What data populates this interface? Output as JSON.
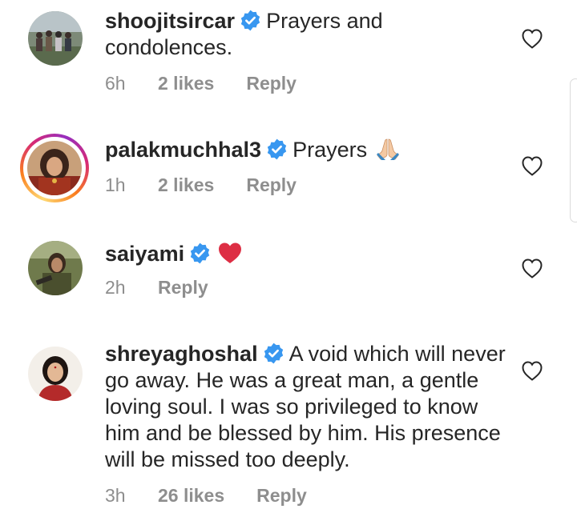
{
  "comments": [
    {
      "username": "shoojitsircar",
      "verified": true,
      "text": "Prayers and condolences.",
      "time": "6h",
      "likes": "2 likes",
      "reply": "Reply"
    },
    {
      "username": "palakmuchhal3",
      "verified": true,
      "text": "Prayers",
      "emoji": "folded-hands-icon",
      "has_story": true,
      "time": "1h",
      "likes": "2 likes",
      "reply": "Reply"
    },
    {
      "username": "saiyami",
      "verified": true,
      "text": "",
      "emoji": "red-heart-icon",
      "time": "2h",
      "reply": "Reply"
    },
    {
      "username": "shreyaghoshal",
      "verified": true,
      "text": "A void which will never go away. He was a great man, a gentle loving soul. I was so privileged to know him and be blessed by him. His presence will be missed too deeply.",
      "time": "3h",
      "likes": "26 likes",
      "reply": "Reply"
    }
  ],
  "colors": {
    "text": "#262626",
    "muted": "#8e8e8e",
    "verified_blue": "#3897f0",
    "heart_red": "#ed4956"
  }
}
